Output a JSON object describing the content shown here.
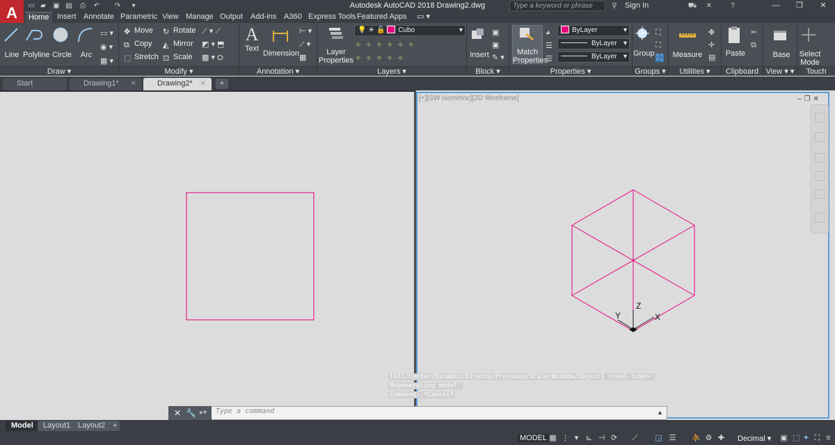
{
  "titlebar": {
    "title": "Autodesk AutoCAD 2018    Drawing2.dwg",
    "search_placeholder": "Type a keyword or phrase",
    "signin": "Sign In"
  },
  "ribbon_tabs": [
    "Home",
    "Insert",
    "Annotate",
    "Parametric",
    "View",
    "Manage",
    "Output",
    "Add-ins",
    "A360",
    "Express Tools",
    "Featured Apps"
  ],
  "panels": {
    "draw": {
      "label": "Draw",
      "buttons": [
        "Line",
        "Polyline",
        "Circle",
        "Arc"
      ]
    },
    "modify": {
      "label": "Modify",
      "row1": [
        "Move",
        "Rotate"
      ],
      "row2": [
        "Copy",
        "Mirror"
      ],
      "row3": [
        "Stretch",
        "Scale"
      ]
    },
    "annotation": {
      "label": "Annotation",
      "buttons": [
        "Text",
        "Dimension"
      ]
    },
    "layers": {
      "label": "Layers",
      "layer_properties": "Layer Properties",
      "current_layer": "Cubo"
    },
    "block": {
      "label": "Block",
      "insert": "Insert"
    },
    "properties": {
      "label": "Properties",
      "match": "Match Properties",
      "color": "ByLayer",
      "linetype": "ByLayer",
      "lineweight": "ByLayer"
    },
    "groups": {
      "label": "Groups",
      "group": "Group"
    },
    "utilities": {
      "label": "Utilities",
      "measure": "Measure"
    },
    "clipboard": {
      "label": "Clipboard",
      "paste": "Paste"
    },
    "view": {
      "label": "View",
      "base": "Base"
    },
    "touch": {
      "label": "Touch",
      "select_mode": "Select Mode"
    }
  },
  "doc_tabs": [
    {
      "label": "Start"
    },
    {
      "label": "Drawing1*"
    },
    {
      "label": "Drawing2*"
    }
  ],
  "viewport": {
    "right_label": "[+][SW Isometric][2D Wireframe]",
    "ucs": {
      "x": "X",
      "y": "Y",
      "z": "Z"
    }
  },
  "command": {
    "history": [
      "[All/Center/Dynamic/Extents/Previous/Scale/Window/Object] <real time>:",
      "Regenerating model.",
      "Command: *Cancel*"
    ],
    "placeholder": "Type a command"
  },
  "layout_tabs": [
    "Model",
    "Layout1",
    "Layout2"
  ],
  "status": {
    "model": "MODEL",
    "units": "Decimal"
  },
  "colors": {
    "accent": "#5b9bd5",
    "drawing": "#e6007e",
    "logo": "#c1272d"
  }
}
